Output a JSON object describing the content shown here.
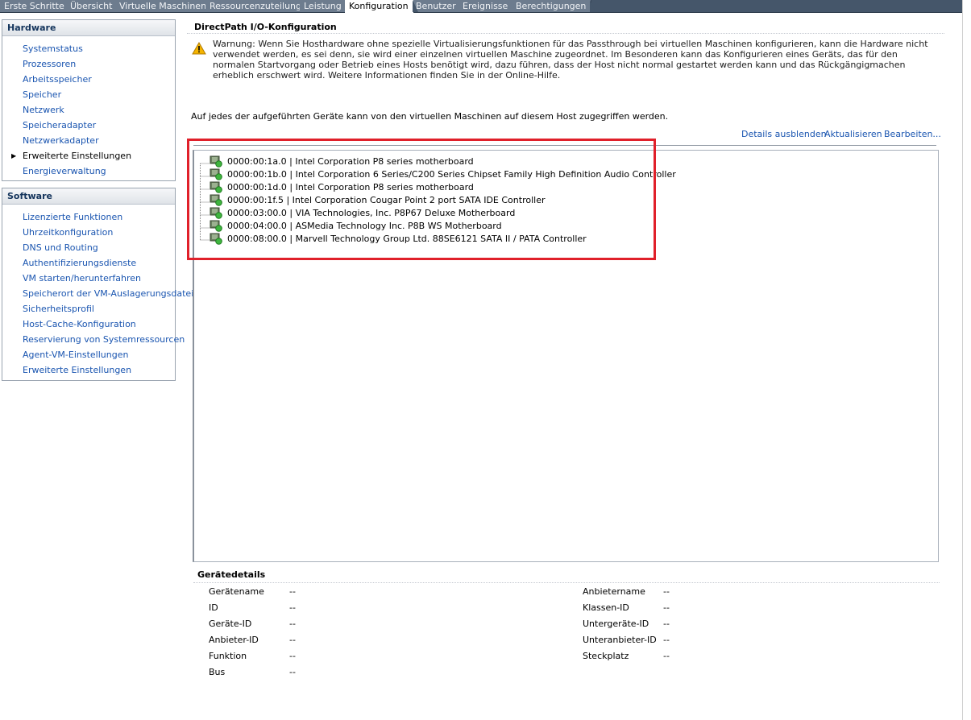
{
  "tabs": [
    {
      "label": "Erste Schritte",
      "active": false
    },
    {
      "label": "Übersicht",
      "active": false
    },
    {
      "label": "Virtuelle Maschinen",
      "active": false
    },
    {
      "label": "Ressourcenzuteilung",
      "active": false
    },
    {
      "label": "Leistung",
      "active": false
    },
    {
      "label": "Konfiguration",
      "active": true
    },
    {
      "label": "Benutzer",
      "active": false
    },
    {
      "label": "Ereignisse",
      "active": false
    },
    {
      "label": "Berechtigungen",
      "active": false
    }
  ],
  "sidebar": {
    "hardware": {
      "title": "Hardware",
      "items": [
        {
          "label": "Systemstatus"
        },
        {
          "label": "Prozessoren"
        },
        {
          "label": "Arbeitsspeicher"
        },
        {
          "label": "Speicher"
        },
        {
          "label": "Netzwerk"
        },
        {
          "label": "Speicheradapter"
        },
        {
          "label": "Netzwerkadapter"
        },
        {
          "label": "Erweiterte Einstellungen",
          "current": true
        },
        {
          "label": "Energieverwaltung"
        }
      ]
    },
    "software": {
      "title": "Software",
      "items": [
        {
          "label": "Lizenzierte Funktionen"
        },
        {
          "label": "Uhrzeitkonfiguration"
        },
        {
          "label": "DNS und Routing"
        },
        {
          "label": "Authentifizierungsdienste"
        },
        {
          "label": "VM starten/herunterfahren"
        },
        {
          "label": "Speicherort der VM-Auslagerungsdatei"
        },
        {
          "label": "Sicherheitsprofil"
        },
        {
          "label": "Host-Cache-Konfiguration"
        },
        {
          "label": "Reservierung von Systemressourcen"
        },
        {
          "label": "Agent-VM-Einstellungen"
        },
        {
          "label": "Erweiterte Einstellungen"
        }
      ]
    }
  },
  "main": {
    "title": "DirectPath I/O-Konfiguration",
    "warning": "Warnung: Wenn Sie Hosthardware ohne spezielle Virtualisierungsfunktionen für das Passthrough bei virtuellen Maschinen konfigurieren, kann die Hardware nicht verwendet werden, es sei denn, sie wird einer einzelnen virtuellen Maschine zugeordnet. Im Besonderen kann das Konfigurieren eines Geräts, das für den normalen Startvorgang oder Betrieb eines Hosts benötigt wird, dazu führen, dass der Host nicht normal gestartet werden kann und das Rückgängigmachen erheblich erschwert wird. Weitere Informationen finden Sie in der Online-Hilfe.",
    "access_text": "Auf jedes der aufgeführten Geräte kann von den virtuellen Maschinen auf diesem Host zugegriffen werden.",
    "actions": {
      "hide_details": "Details ausblenden",
      "refresh": "Aktualisieren",
      "edit": "Bearbeiten..."
    },
    "devices": [
      "0000:00:1a.0 | Intel Corporation P8 series motherboard",
      "0000:00:1b.0 | Intel Corporation 6 Series/C200 Series Chipset Family High Definition Audio Controller",
      "0000:00:1d.0 | Intel Corporation P8 series motherboard",
      "0000:00:1f.5 | Intel Corporation Cougar Point 2 port SATA IDE Controller",
      "0000:03:00.0 | VIA Technologies, Inc. P8P67 Deluxe Motherboard",
      "0000:04:00.0 | ASMedia Technology Inc. P8B WS Motherboard",
      "0000:08:00.0 | Marvell Technology Group Ltd. 88SE6121 SATA II / PATA Controller"
    ]
  },
  "details": {
    "title": "Gerätedetails",
    "left": [
      {
        "label": "Gerätename",
        "value": "--"
      },
      {
        "label": "ID",
        "value": "--"
      },
      {
        "label": "Geräte-ID",
        "value": "--"
      },
      {
        "label": "Anbieter-ID",
        "value": "--"
      },
      {
        "label": "Funktion",
        "value": "--"
      },
      {
        "label": "Bus",
        "value": "--"
      }
    ],
    "right": [
      {
        "label": "Anbietername",
        "value": "--"
      },
      {
        "label": "Klassen-ID",
        "value": "--"
      },
      {
        "label": "Untergeräte-ID",
        "value": "--"
      },
      {
        "label": "Unteranbieter-ID",
        "value": "--"
      },
      {
        "label": "Steckplatz",
        "value": "--"
      }
    ]
  },
  "colors": {
    "link": "#1a55b0",
    "highlight": "#e0202a",
    "tabbar": "#45566a"
  }
}
